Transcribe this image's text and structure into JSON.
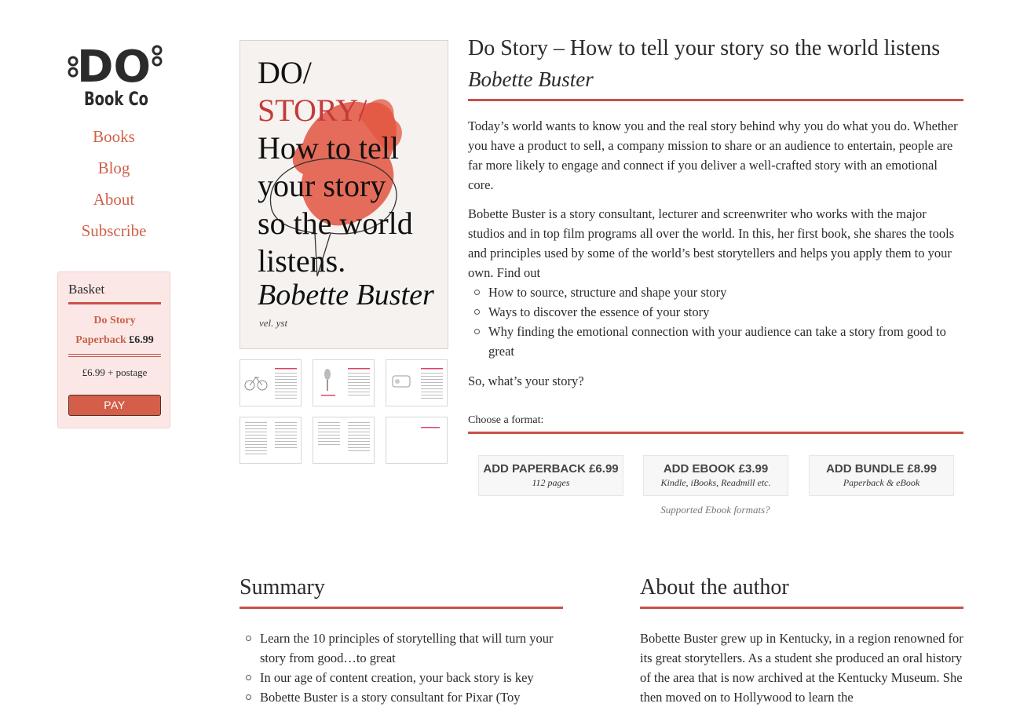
{
  "brand": {
    "logo_text_top": "DO",
    "logo_text_bottom": "Book Co"
  },
  "nav": {
    "items": [
      {
        "label": "Books"
      },
      {
        "label": "Blog"
      },
      {
        "label": "About"
      },
      {
        "label": "Subscribe"
      }
    ]
  },
  "basket": {
    "title": "Basket",
    "item_name": "Do Story",
    "item_format": "Paperback",
    "item_price": "£6.99",
    "total": "£6.99 + postage",
    "pay_label": "PAY"
  },
  "cover": {
    "line1": "DO/",
    "line2": "STORY/",
    "line3": "How to tell",
    "line4": "your story",
    "line5": "so the world",
    "line6": "listens.",
    "author": "Bobette Buster",
    "signature": "vel. yst"
  },
  "book": {
    "title": "Do Story – How to tell your story so the world listens",
    "author": "Bobette Buster",
    "description_p1": "Today’s world wants to know you and the real story behind why you do what you do. Whether you have a product to sell, a company mission to share or an audience to entertain, people are far more likely to engage and connect if you deliver a well-crafted story with an emotional core.",
    "description_p2": "Bobette Buster is a story consultant, lecturer and screenwriter who works with the major studios and in top film programs all over the world. In this, her first book, she shares the tools and principles used by some of the world’s best storytellers and helps you apply them to your own. Find out",
    "bullets": [
      "How to source, structure and shape your story",
      "Ways to discover the essence of your story",
      "Why finding the emotional connection with your audience can take a story from good to great"
    ],
    "closing": "So, what’s your story?"
  },
  "formats": {
    "label": "Choose a format:",
    "options": [
      {
        "label": "ADD PAPERBACK £6.99",
        "sub": "112 pages"
      },
      {
        "label": "ADD EBOOK £3.99",
        "sub": "Kindle, iBooks, Readmill etc."
      },
      {
        "label": "ADD BUNDLE £8.99",
        "sub": "Paperback & eBook"
      }
    ],
    "supported_link": "Supported Ebook formats?"
  },
  "summary": {
    "title": "Summary",
    "items": [
      "Learn the 10 principles of storytelling that will turn your story from good…to great",
      "In our age of content creation, your back story is key",
      "Bobette Buster is a story consultant for Pixar (Toy"
    ]
  },
  "about_author": {
    "title": "About the author",
    "text": "Bobette Buster grew up in Kentucky, in a region renowned for its great storytellers. As a student she produced an oral history of the area that is now archived at the Kentucky Museum. She then moved on to Hollywood to learn the"
  },
  "colors": {
    "accent": "#c9514a",
    "nav_link": "#d0614a",
    "basket_bg": "#fbe8e6",
    "pay_button": "#d35e4a"
  }
}
